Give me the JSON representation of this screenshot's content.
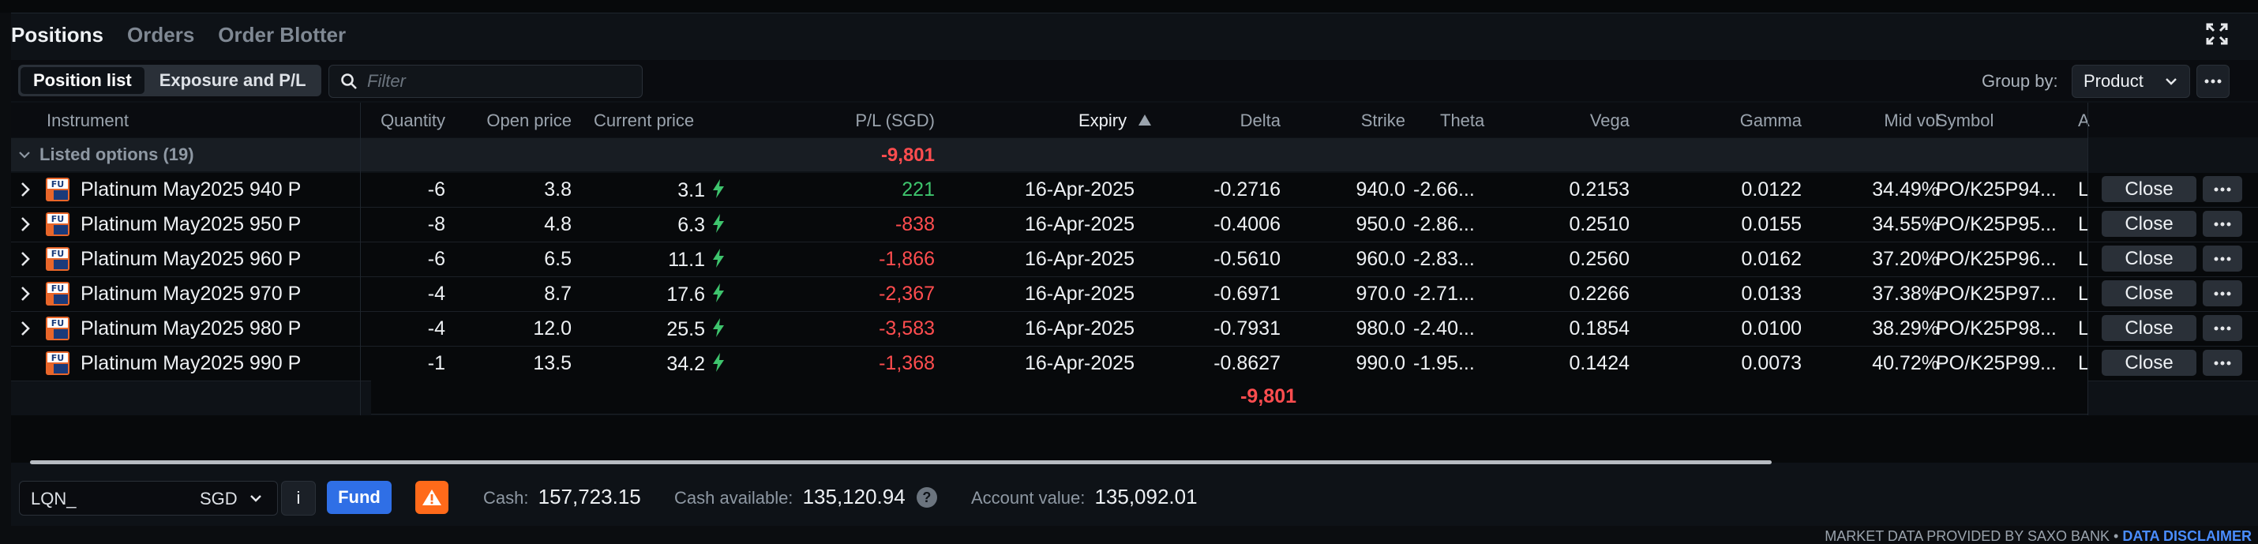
{
  "tabs": [
    {
      "label": "Positions",
      "active": true
    },
    {
      "label": "Orders",
      "active": false
    },
    {
      "label": "Order Blotter",
      "active": false
    }
  ],
  "toolbar": {
    "views": [
      {
        "label": "Position list",
        "active": true
      },
      {
        "label": "Exposure and P/L",
        "active": false
      }
    ],
    "filter_placeholder": "Filter",
    "group_by_label": "Group by:",
    "group_by_value": "Product"
  },
  "columns": {
    "instrument": "Instrument",
    "quantity": "Quantity",
    "open_price": "Open price",
    "current_price": "Current price",
    "pl": "P/L (SGD)",
    "expiry": "Expiry",
    "delta": "Delta",
    "strike": "Strike",
    "theta": "Theta",
    "vega": "Vega",
    "gamma": "Gamma",
    "mid_vol": "Mid vol",
    "symbol": "Symbol",
    "asset": "A"
  },
  "group": {
    "label": "Listed options (19)",
    "pl": "-9,801"
  },
  "rows": [
    {
      "instrument": "Platinum May2025 940 P",
      "quantity": "-6",
      "open_price": "3.8",
      "current_price": "3.1",
      "pl": "221",
      "pl_sign": "pos",
      "expiry": "16-Apr-2025",
      "delta": "-0.2716",
      "strike": "940.0",
      "theta": "-2.66...",
      "vega": "0.2153",
      "gamma": "0.0122",
      "mid_vol": "34.49%",
      "symbol": "PO/K25P94...",
      "asset": "L",
      "expandable": true
    },
    {
      "instrument": "Platinum May2025 950 P",
      "quantity": "-8",
      "open_price": "4.8",
      "current_price": "6.3",
      "pl": "-838",
      "pl_sign": "neg",
      "expiry": "16-Apr-2025",
      "delta": "-0.4006",
      "strike": "950.0",
      "theta": "-2.86...",
      "vega": "0.2510",
      "gamma": "0.0155",
      "mid_vol": "34.55%",
      "symbol": "PO/K25P95...",
      "asset": "L",
      "expandable": true
    },
    {
      "instrument": "Platinum May2025 960 P",
      "quantity": "-6",
      "open_price": "6.5",
      "current_price": "11.1",
      "pl": "-1,866",
      "pl_sign": "neg",
      "expiry": "16-Apr-2025",
      "delta": "-0.5610",
      "strike": "960.0",
      "theta": "-2.83...",
      "vega": "0.2560",
      "gamma": "0.0162",
      "mid_vol": "37.20%",
      "symbol": "PO/K25P96...",
      "asset": "L",
      "expandable": true
    },
    {
      "instrument": "Platinum May2025 970 P",
      "quantity": "-4",
      "open_price": "8.7",
      "current_price": "17.6",
      "pl": "-2,367",
      "pl_sign": "neg",
      "expiry": "16-Apr-2025",
      "delta": "-0.6971",
      "strike": "970.0",
      "theta": "-2.71...",
      "vega": "0.2266",
      "gamma": "0.0133",
      "mid_vol": "37.38%",
      "symbol": "PO/K25P97...",
      "asset": "L",
      "expandable": true
    },
    {
      "instrument": "Platinum May2025 980 P",
      "quantity": "-4",
      "open_price": "12.0",
      "current_price": "25.5",
      "pl": "-3,583",
      "pl_sign": "neg",
      "expiry": "16-Apr-2025",
      "delta": "-0.7931",
      "strike": "980.0",
      "theta": "-2.40...",
      "vega": "0.1854",
      "gamma": "0.0100",
      "mid_vol": "38.29%",
      "symbol": "PO/K25P98...",
      "asset": "L",
      "expandable": true
    },
    {
      "instrument": "Platinum May2025 990 P",
      "quantity": "-1",
      "open_price": "13.5",
      "current_price": "34.2",
      "pl": "-1,368",
      "pl_sign": "neg",
      "expiry": "16-Apr-2025",
      "delta": "-0.8627",
      "strike": "990.0",
      "theta": "-1.95...",
      "vega": "0.1424",
      "gamma": "0.0073",
      "mid_vol": "40.72%",
      "symbol": "PO/K25P99...",
      "asset": "L",
      "expandable": false
    }
  ],
  "row_action": {
    "close_label": "Close"
  },
  "total_pl": "-9,801",
  "footer": {
    "account_id": "LQN_",
    "currency": "SGD",
    "info_label": "i",
    "fund_label": "Fund",
    "cash_label": "Cash:",
    "cash_value": "157,723.15",
    "cash_available_label": "Cash available:",
    "cash_available_value": "135,120.94",
    "help_label": "?",
    "account_value_label": "Account value:",
    "account_value_value": "135,092.01"
  },
  "disclaimer": {
    "text": "MARKET DATA PROVIDED BY SAXO BANK",
    "separator": "•",
    "link": "DATA DISCLAIMER"
  },
  "colors": {
    "positive": "#3ec46d",
    "negative": "#ff4d4f",
    "fund_button": "#2f6fe6",
    "warning": "#ff6a1a",
    "product_icon": "#e8662a"
  },
  "icons": {
    "expand": "fullscreen-icon",
    "search": "search-icon",
    "chevron": "chevron-down-icon",
    "more": "more-icon",
    "row_expand": "chevron-right-icon",
    "product": "futures-option-icon",
    "bolt": "lightning-icon",
    "warning": "warning-icon",
    "sort": "sort-ascending-icon"
  }
}
